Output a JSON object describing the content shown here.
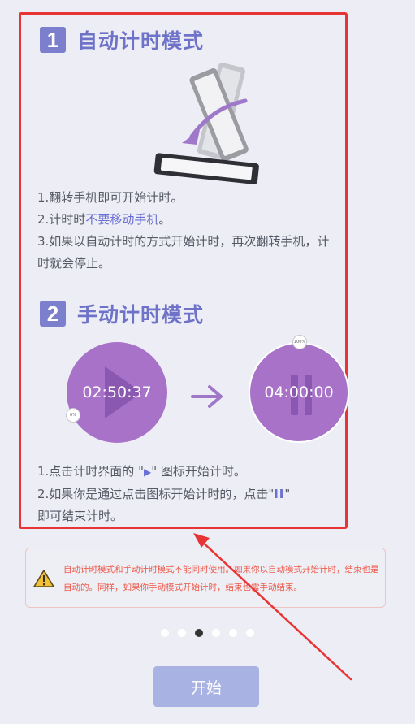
{
  "section1": {
    "number": "1",
    "title": "自动计时模式",
    "line1": "1.翻转手机即可开始计时。",
    "line2_prefix": "2.计时时",
    "line2_highlight": "不要移动手机",
    "line2_suffix": "。",
    "line3": "3.如果以自动计时的方式开始计时，再次翻转手机，计时就会停止。"
  },
  "section2": {
    "number": "2",
    "title": "手动计时模式",
    "timer_left": "02:50:37",
    "timer_left_badge": "6%",
    "timer_right": "04:00:00",
    "timer_right_badge": "100%",
    "line1_prefix": "1.点击计时界面的 \"",
    "line1_icon": "▶",
    "line1_suffix": "\" 图标开始计时。",
    "line2_prefix": "2.如果你是通过点击图标开始计时的，点击\"",
    "line2_icon": "II",
    "line2_suffix": "\"",
    "line3": "即可结束计时。"
  },
  "warning": {
    "text": "自动计时模式和手动计时模式不能同时使用。如果你以自动模式开始计时，结束也是自动的。同样，如果你手动模式开始计时，结束也需手动结束。"
  },
  "pager": {
    "total": 6,
    "active_index": 2
  },
  "start_button": {
    "label": "开始"
  },
  "colors": {
    "accent": "#6e72c8",
    "timer": "#a772c8",
    "warning": "#ee5a4a",
    "annotation": "#e83434",
    "button": "#a9b3e3"
  }
}
